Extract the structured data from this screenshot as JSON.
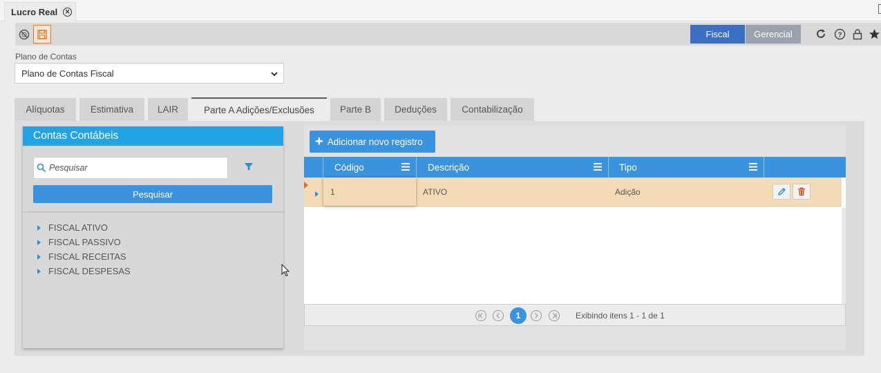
{
  "window_tab": {
    "title": "Lucro Real"
  },
  "toolbar": {
    "fiscal_label": "Fiscal",
    "gerencial_label": "Gerencial",
    "active_segment": "Fiscal"
  },
  "plano": {
    "label": "Plano de Contas",
    "selected": "Plano de Contas Fiscal"
  },
  "tabs": [
    {
      "label": "Alíquotas"
    },
    {
      "label": "Estimativa"
    },
    {
      "label": "LAIR"
    },
    {
      "label": "Parte A Adições/Exclusões"
    },
    {
      "label": "Parte B"
    },
    {
      "label": "Deduções"
    },
    {
      "label": "Contabilização"
    }
  ],
  "active_tab": "Parte A Adições/Exclusões",
  "contas": {
    "title": "Contas Contábeis",
    "search_placeholder": "Pesquisar",
    "search_button": "Pesquisar",
    "tree": [
      {
        "label": "FISCAL ATIVO"
      },
      {
        "label": "FISCAL PASSIVO"
      },
      {
        "label": "FISCAL RECEITAS"
      },
      {
        "label": "FISCAL DESPESAS"
      }
    ]
  },
  "grid": {
    "add_button": "Adicionar novo registro",
    "columns": [
      {
        "label": "Código"
      },
      {
        "label": "Descrição"
      },
      {
        "label": "Tipo"
      }
    ],
    "rows": [
      {
        "codigo": "1",
        "descricao": "ATIVO",
        "tipo": "Adição"
      }
    ],
    "pager": {
      "current_page": "1",
      "info": "Exibindo itens 1 - 1 de 1"
    }
  },
  "colors": {
    "accent_blue": "#3a93dc",
    "header_blue": "#22a3e6",
    "fiscal_blue": "#3a6fc3",
    "selected_row": "#f3dcb5",
    "save_orange": "#e07b2e"
  }
}
